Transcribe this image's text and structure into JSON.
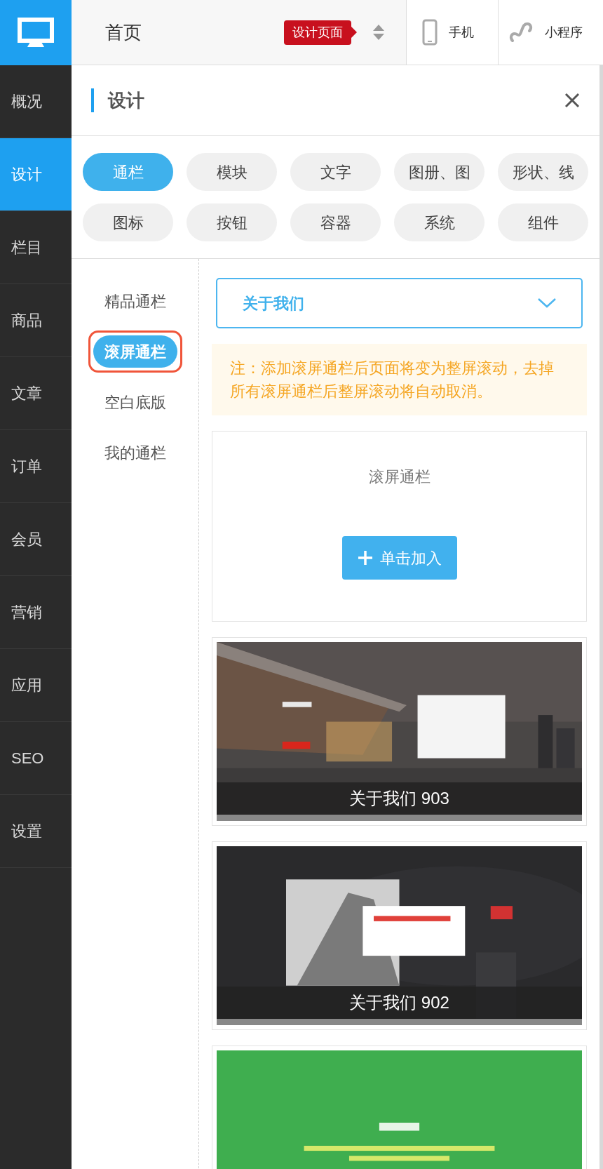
{
  "top_bar": {
    "page": "首页",
    "tag": "设计页面",
    "modes": [
      {
        "label": "手机",
        "kind": "phone"
      },
      {
        "label": "小程序",
        "kind": "miniapp"
      }
    ]
  },
  "sidebar": {
    "items": [
      {
        "label": "概况",
        "selected": false
      },
      {
        "label": "设计",
        "selected": true
      },
      {
        "label": "栏目",
        "selected": false
      },
      {
        "label": "商品",
        "selected": false
      },
      {
        "label": "文章",
        "selected": false
      },
      {
        "label": "订单",
        "selected": false
      },
      {
        "label": "会员",
        "selected": false
      },
      {
        "label": "营销",
        "selected": false
      },
      {
        "label": "应用",
        "selected": false
      },
      {
        "label": "SEO",
        "selected": false
      },
      {
        "label": "设置",
        "selected": false
      }
    ]
  },
  "panel": {
    "title": "设计",
    "categories": [
      {
        "label": "通栏",
        "selected": true
      },
      {
        "label": "模块",
        "selected": false
      },
      {
        "label": "文字",
        "selected": false
      },
      {
        "label": "图册、图",
        "selected": false
      },
      {
        "label": "形状、线",
        "selected": false
      },
      {
        "label": "图标",
        "selected": false
      },
      {
        "label": "按钮",
        "selected": false
      },
      {
        "label": "容器",
        "selected": false
      },
      {
        "label": "系统",
        "selected": false
      },
      {
        "label": "组件",
        "selected": false
      }
    ],
    "subcategories": [
      {
        "label": "精品通栏",
        "selected": false,
        "highlighted": false
      },
      {
        "label": "滚屏通栏",
        "selected": true,
        "highlighted": true
      },
      {
        "label": "空白底版",
        "selected": false,
        "highlighted": false
      },
      {
        "label": "我的通栏",
        "selected": false,
        "highlighted": false
      }
    ],
    "dropdown": {
      "value": "关于我们"
    },
    "notice": "注：添加滚屏通栏后页面将变为整屏滚动，去掉所有滚屏通栏后整屏滚动将自动取消。",
    "blank_card": {
      "title": "滚屏通栏",
      "button": "单击加入"
    },
    "templates": [
      {
        "caption": "关于我们 903"
      },
      {
        "caption": "关于我们 902"
      },
      {
        "kind": "picture"
      }
    ]
  }
}
